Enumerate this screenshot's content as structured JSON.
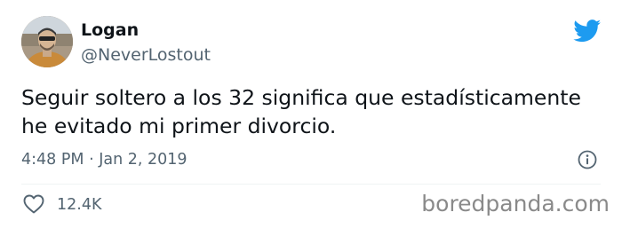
{
  "tweet": {
    "display_name": "Logan",
    "handle": "@NeverLostout",
    "text_line1": "Seguir soltero a los 32 significa que estadísticamente",
    "text_line2": "he evitado mi primer divorcio.",
    "timestamp": "4:48 PM · Jan 2, 2019",
    "likes": "12.4K"
  },
  "icons": {
    "avatar": "avatar",
    "bird": "twitter-bird-icon",
    "info": "info-icon",
    "heart": "heart-icon"
  },
  "colors": {
    "brand": "#1d9bf0",
    "secondary_text": "#536471",
    "primary_text": "#0f1419",
    "divider": "#eff3f4"
  },
  "watermark": {
    "text": "boredpanda.com"
  }
}
